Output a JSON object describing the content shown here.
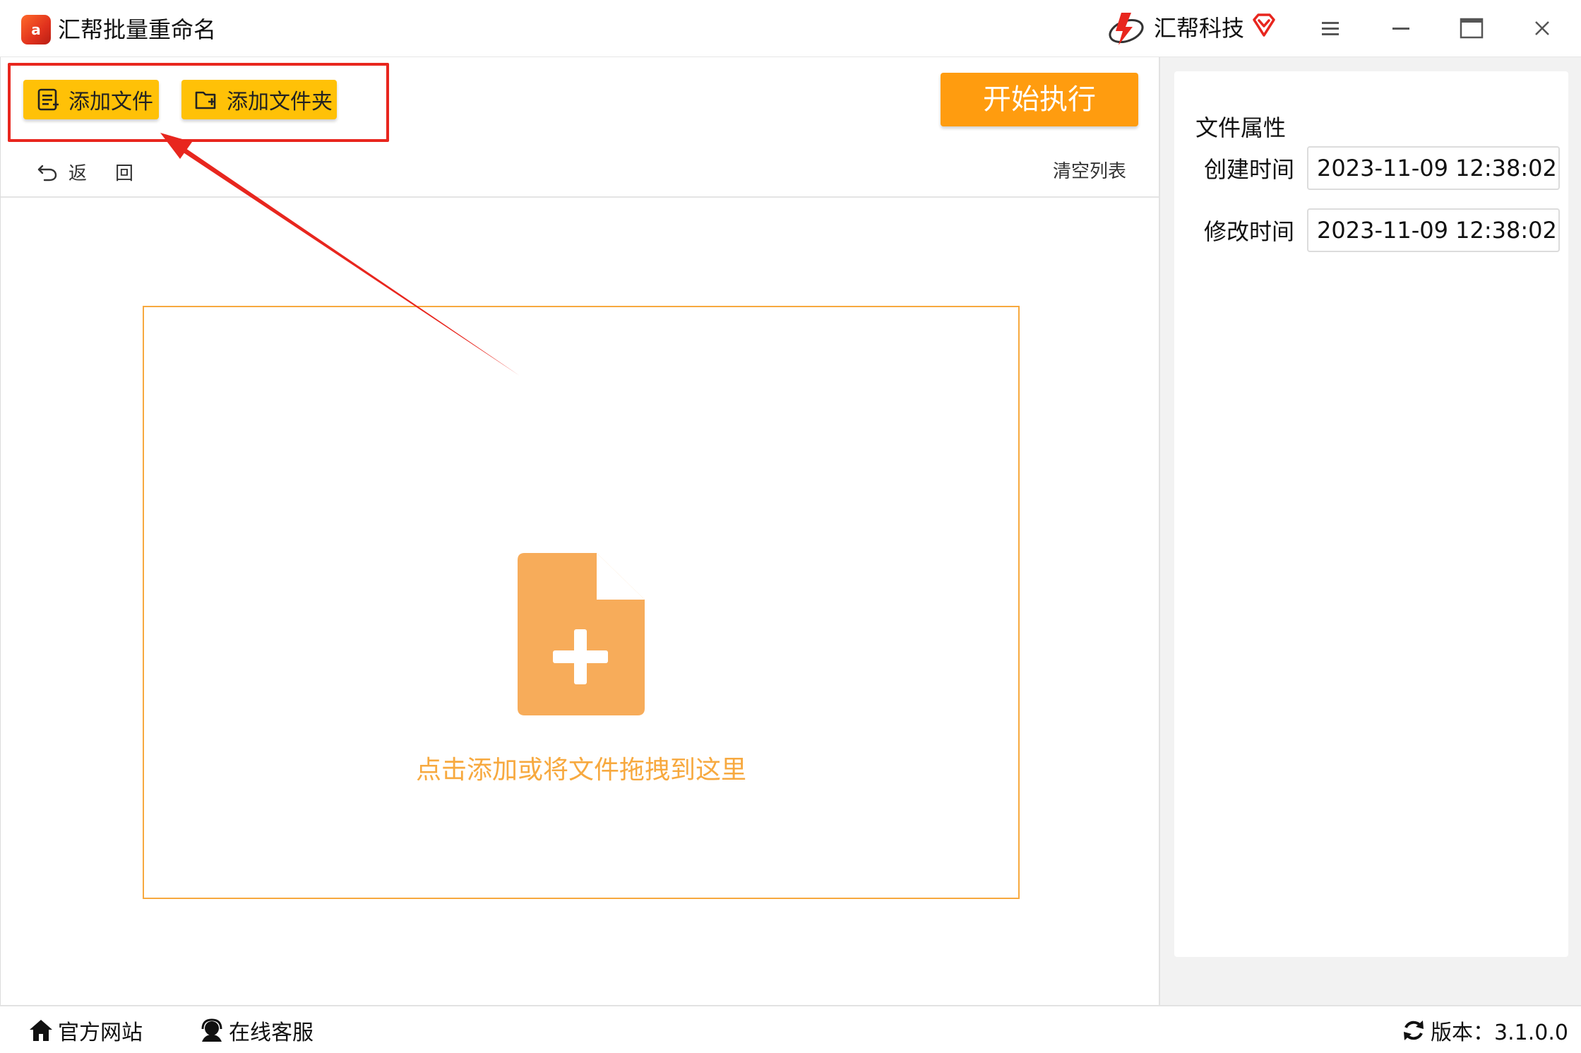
{
  "window": {
    "title": "汇帮批量重命名",
    "logo_text": "a",
    "brand_name": "汇帮科技"
  },
  "toolbar": {
    "add_file_label": "添加文件",
    "add_folder_label": "添加文件夹",
    "start_label": "开始执行",
    "back_label": "返回",
    "clear_list_label": "清空列表"
  },
  "dropzone": {
    "hint": "点击添加或将文件拖拽到这里"
  },
  "properties": {
    "title": "文件属性",
    "created_label": "创建时间",
    "created_value": "2023-11-09 12:38:02",
    "modified_label": "修改时间",
    "modified_value": "2023-11-09 12:38:02"
  },
  "footer": {
    "website_label": "官方网站",
    "service_label": "在线客服",
    "version_label": "版本：3.1.0.0"
  },
  "colors": {
    "accent_yellow": "#ffc107",
    "start_orange": "#ff9c0f",
    "drop_orange": "#f7a93f",
    "highlight_red": "#e8261e"
  }
}
